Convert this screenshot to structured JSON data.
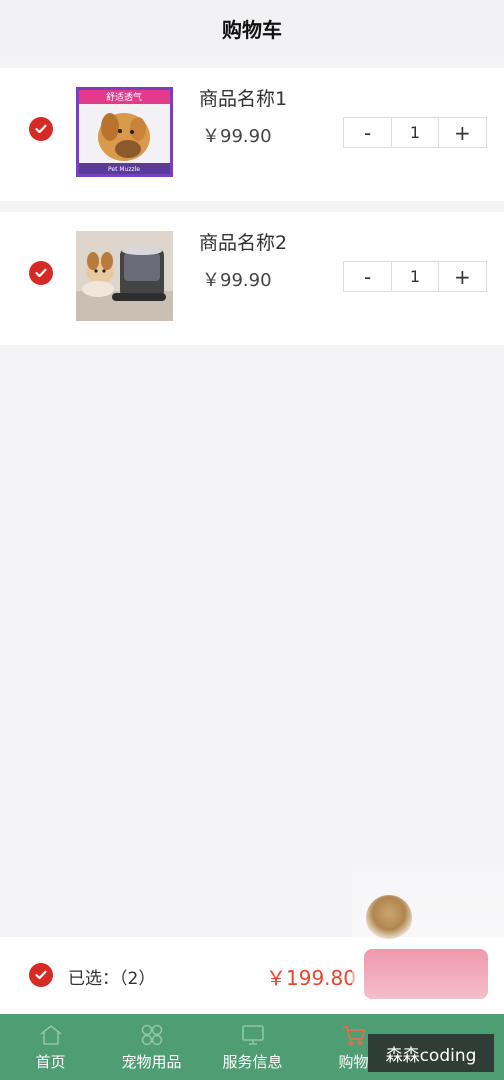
{
  "header": {
    "title": "购物车"
  },
  "cart": {
    "items": [
      {
        "name": "商品名称1",
        "price": "￥99.90",
        "quantity": "1",
        "minus": "-",
        "plus": "+",
        "checked": true,
        "image": "dog-muzzle-product"
      },
      {
        "name": "商品名称2",
        "price": "￥99.90",
        "quantity": "1",
        "minus": "-",
        "plus": "+",
        "checked": true,
        "image": "pet-feeder-product"
      }
    ]
  },
  "footer": {
    "selected_label": "已选：（2）",
    "total": "￥199.80",
    "checkout_label": "",
    "all_checked": true
  },
  "tabbar": {
    "items": [
      {
        "label": "首页",
        "icon": "home-icon"
      },
      {
        "label": "宠物用品",
        "icon": "clover-icon"
      },
      {
        "label": "服务信息",
        "icon": "monitor-icon"
      },
      {
        "label": "购物",
        "icon": "cart-icon"
      }
    ]
  },
  "watermark": {
    "text": "森森coding"
  },
  "colors": {
    "accent_red": "#d62b24",
    "price_red": "#e5462f",
    "tabbar_green": "#4f9d73",
    "checkout_pink": "#e0325c"
  }
}
